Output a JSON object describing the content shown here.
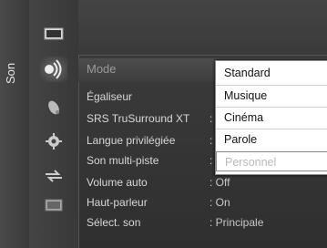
{
  "side_tab": {
    "label": "Son"
  },
  "icons": [
    "picture-icon",
    "sound-icon",
    "channel-icon",
    "settings-icon",
    "input-icon",
    "application-icon"
  ],
  "menu": {
    "mode_label": "Mode",
    "items": [
      {
        "label": "Égaliseur",
        "value": ""
      },
      {
        "label": "SRS TruSurround XT",
        "value": ":"
      },
      {
        "label": "Langue privilégiée",
        "value": ":"
      },
      {
        "label": "Son multi-piste",
        "value": ":"
      },
      {
        "label": "Volume auto",
        "value": ": Off"
      },
      {
        "label": "Haut-parleur",
        "value": ": On"
      },
      {
        "label": "Sélect. son",
        "value": ": Principale"
      }
    ]
  },
  "dropdown": {
    "options": [
      "Standard",
      "Musique",
      "Cinéma",
      "Parole",
      "Personnel"
    ],
    "selected_index": 0,
    "disabled_index": 4
  }
}
